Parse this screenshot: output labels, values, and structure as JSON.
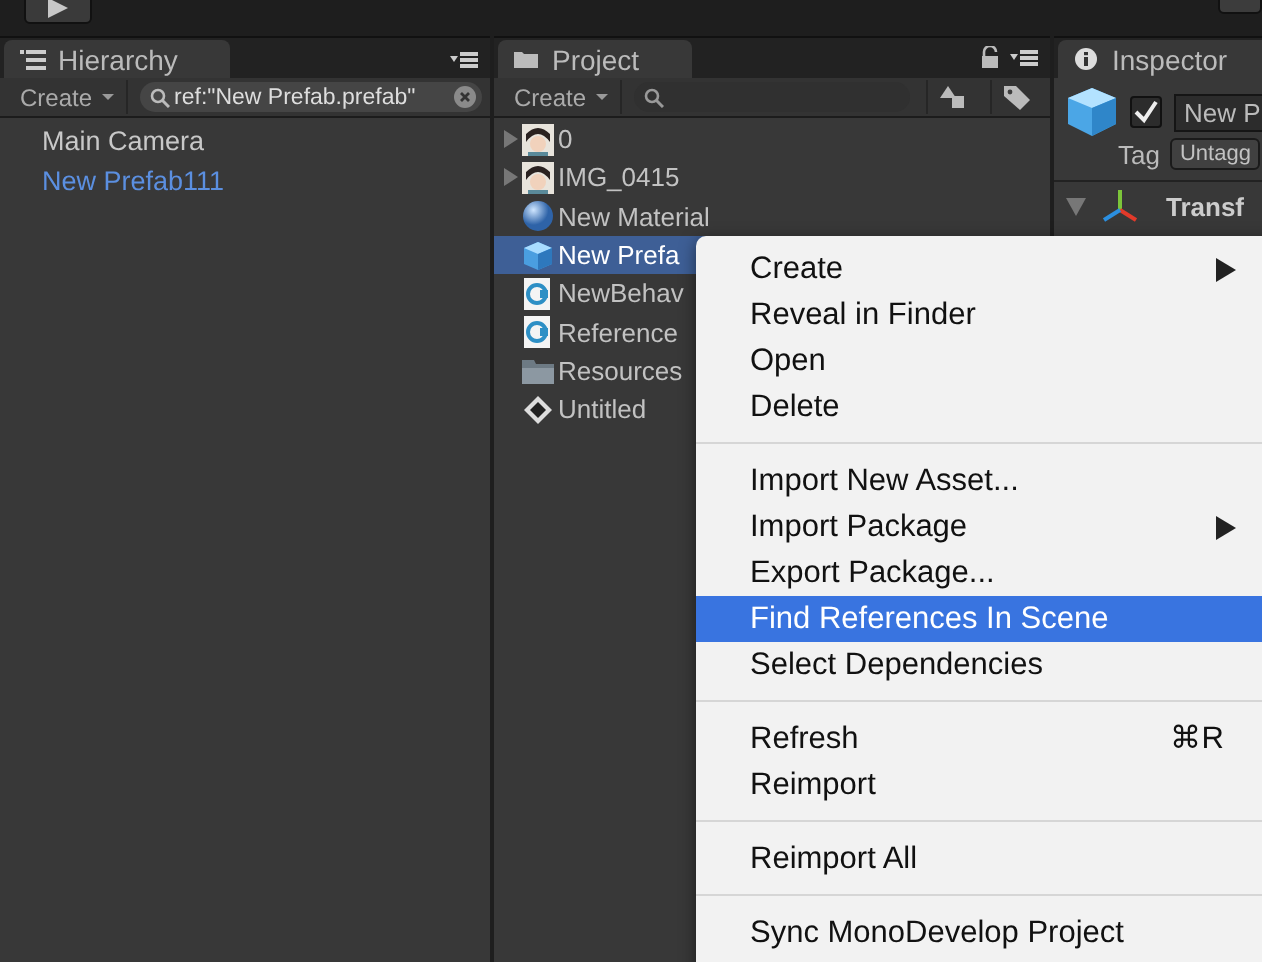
{
  "hierarchy": {
    "title": "Hierarchy",
    "create": "Create",
    "search": {
      "value": "ref:\"New Prefab.prefab\""
    },
    "items": [
      {
        "label": "Main Camera",
        "selected": false
      },
      {
        "label": "New Prefab111",
        "selected": true
      }
    ]
  },
  "project": {
    "title": "Project",
    "create": "Create",
    "items": [
      {
        "label": "0",
        "expandable": true,
        "selected": false
      },
      {
        "label": "IMG_0415",
        "expandable": true,
        "selected": false
      },
      {
        "label": "New Material",
        "kind": "material",
        "expandable": false,
        "selected": false
      },
      {
        "label": "New Prefa",
        "kind": "prefab",
        "expandable": false,
        "selected": true
      },
      {
        "label": "NewBehav",
        "kind": "script",
        "expandable": false,
        "selected": false
      },
      {
        "label": "Reference",
        "kind": "script",
        "expandable": false,
        "selected": false
      },
      {
        "label": "Resources",
        "kind": "folder",
        "expandable": false,
        "selected": false
      },
      {
        "label": "Untitled",
        "kind": "scene",
        "expandable": false,
        "selected": false
      }
    ]
  },
  "inspector": {
    "title": "Inspector",
    "active": true,
    "name": "New P",
    "tag_label": "Tag",
    "tag": "Untagg",
    "component": "Transf"
  },
  "context_menu": [
    {
      "kind": "item",
      "label": "Create",
      "submenu": true,
      "selected": false
    },
    {
      "kind": "item",
      "label": "Reveal in Finder",
      "submenu": false,
      "selected": false
    },
    {
      "kind": "item",
      "label": "Open",
      "submenu": false,
      "selected": false
    },
    {
      "kind": "item",
      "label": "Delete",
      "submenu": false,
      "selected": false
    },
    {
      "kind": "separator"
    },
    {
      "kind": "item",
      "label": "Import New Asset...",
      "submenu": false,
      "selected": false
    },
    {
      "kind": "item",
      "label": "Import Package",
      "submenu": true,
      "selected": false
    },
    {
      "kind": "item",
      "label": "Export Package...",
      "submenu": false,
      "selected": false
    },
    {
      "kind": "item",
      "label": "Find References In Scene",
      "submenu": false,
      "selected": true
    },
    {
      "kind": "item",
      "label": "Select Dependencies",
      "submenu": false,
      "selected": false
    },
    {
      "kind": "separator"
    },
    {
      "kind": "item",
      "label": "Refresh",
      "shortcut": "⌘R",
      "submenu": false,
      "selected": false
    },
    {
      "kind": "item",
      "label": "Reimport",
      "submenu": false,
      "selected": false
    },
    {
      "kind": "separator"
    },
    {
      "kind": "item",
      "label": "Reimport All",
      "submenu": false,
      "selected": false
    },
    {
      "kind": "separator"
    },
    {
      "kind": "item",
      "label": "Sync MonoDevelop Project",
      "submenu": false,
      "selected": false
    }
  ]
}
